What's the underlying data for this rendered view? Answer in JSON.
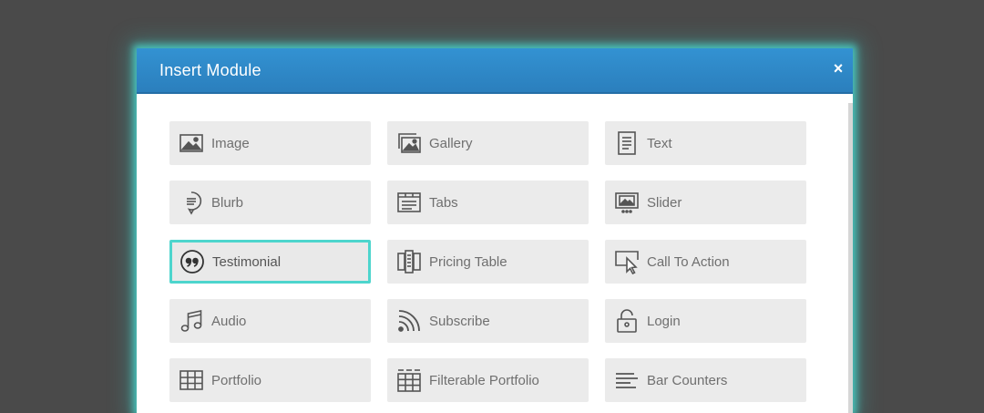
{
  "modal": {
    "title": "Insert Module",
    "close_label": "×"
  },
  "modules": [
    {
      "label": "Image",
      "icon": "image-icon"
    },
    {
      "label": "Gallery",
      "icon": "gallery-icon"
    },
    {
      "label": "Text",
      "icon": "text-icon"
    },
    {
      "label": "Blurb",
      "icon": "blurb-icon"
    },
    {
      "label": "Tabs",
      "icon": "tabs-icon"
    },
    {
      "label": "Slider",
      "icon": "slider-icon"
    },
    {
      "label": "Testimonial",
      "icon": "testimonial-icon",
      "selected": true
    },
    {
      "label": "Pricing Table",
      "icon": "pricing-table-icon"
    },
    {
      "label": "Call To Action",
      "icon": "call-to-action-icon"
    },
    {
      "label": "Audio",
      "icon": "audio-icon"
    },
    {
      "label": "Subscribe",
      "icon": "subscribe-icon"
    },
    {
      "label": "Login",
      "icon": "login-icon"
    },
    {
      "label": "Portfolio",
      "icon": "portfolio-icon"
    },
    {
      "label": "Filterable Portfolio",
      "icon": "filterable-portfolio-icon"
    },
    {
      "label": "Bar Counters",
      "icon": "bar-counters-icon"
    }
  ],
  "colors": {
    "backdrop": "#4a4a4a",
    "header": "#2f88c8",
    "tile": "#ebebeb",
    "selected_border": "#4dd5cd",
    "icon": "#555555"
  }
}
